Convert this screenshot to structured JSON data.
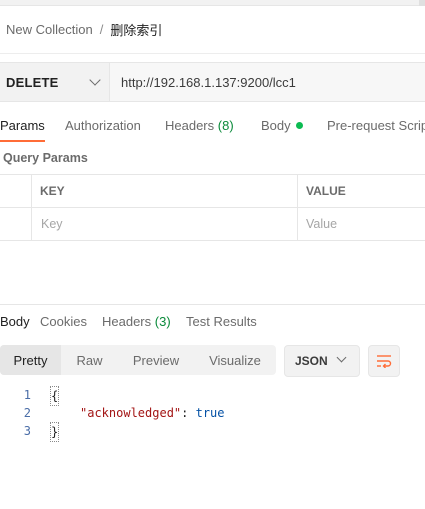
{
  "breadcrumb": {
    "collection": "New Collection",
    "separator": "/",
    "request": "删除索引"
  },
  "request": {
    "method": "DELETE",
    "url": "http://192.168.1.137:9200/lcc1"
  },
  "request_tabs": {
    "params": "Params",
    "authorization": "Authorization",
    "headers_label": "Headers",
    "headers_count": "(8)",
    "body": "Body",
    "body_dot_color": "#0cbb52",
    "prerequest": "Pre-request Scrip"
  },
  "query_params": {
    "title": "Query Params",
    "columns": {
      "key": "KEY",
      "value": "VALUE"
    },
    "placeholders": {
      "key": "Key",
      "value": "Value"
    }
  },
  "response_tabs": {
    "body": "Body",
    "cookies": "Cookies",
    "headers_label": "Headers",
    "headers_count": "(3)",
    "test_results": "Test Results"
  },
  "format_options": {
    "pretty": "Pretty",
    "raw": "Raw",
    "preview": "Preview",
    "visualize": "Visualize",
    "selected": "Pretty"
  },
  "language": {
    "selected": "JSON"
  },
  "response_body": {
    "lines": [
      {
        "num": "1",
        "open": "{"
      },
      {
        "num": "2",
        "key": "\"acknowledged\"",
        "colon": ": ",
        "value": "true"
      },
      {
        "num": "3",
        "close": "}"
      }
    ]
  },
  "colors": {
    "accent": "#ff6c37",
    "count_green": "#0a8a3a"
  }
}
